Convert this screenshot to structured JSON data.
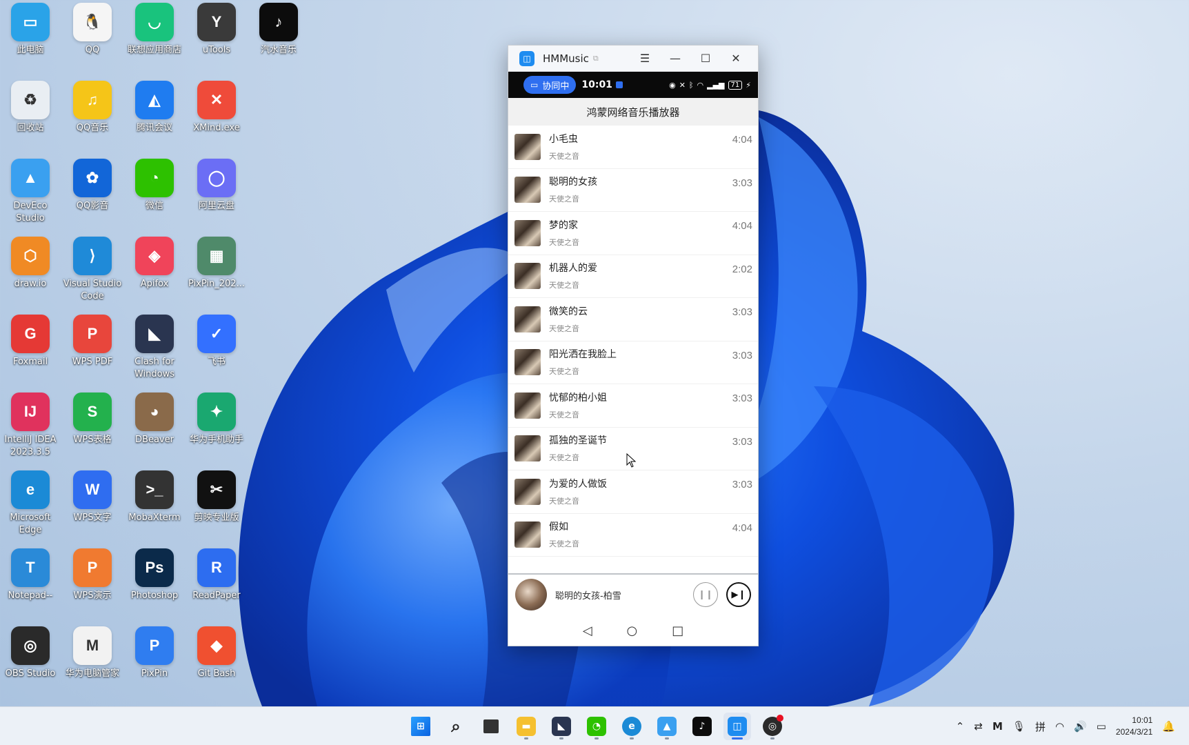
{
  "desktop": {
    "icons": [
      {
        "label": "此电脑",
        "color": "#2aa3e8",
        "glyph": "▭"
      },
      {
        "label": "QQ",
        "color": "#f5f5f5",
        "glyph": "🐧"
      },
      {
        "label": "联想应用商店",
        "color": "#19c37d",
        "glyph": "◡"
      },
      {
        "label": "uTools",
        "color": "#3a3a3a",
        "glyph": "Y"
      },
      {
        "label": "汽水音乐",
        "color": "#0c0c0c",
        "glyph": "♪"
      },
      {
        "label": "回收站",
        "color": "#e9eef3",
        "glyph": "♻"
      },
      {
        "label": "QQ音乐",
        "color": "#f5c518",
        "glyph": "♫"
      },
      {
        "label": "腾讯会议",
        "color": "#1f7cf0",
        "glyph": "◭"
      },
      {
        "label": "XMind.exe",
        "color": "#ef4b3a",
        "glyph": "✕"
      },
      {
        "label": "DevEco Studio",
        "color": "#3aa0f0",
        "glyph": "▲"
      },
      {
        "label": "QQ影音",
        "color": "#1266d8",
        "glyph": "✿"
      },
      {
        "label": "微信",
        "color": "#2dc100",
        "glyph": "◔"
      },
      {
        "label": "阿里云盘",
        "color": "#6b6ef5",
        "glyph": "◯"
      },
      {
        "label": "draw.io",
        "color": "#f08a24",
        "glyph": "⬡"
      },
      {
        "label": "Visual Studio Code",
        "color": "#1f8ad8",
        "glyph": "⟩"
      },
      {
        "label": "Apifox",
        "color": "#f0445a",
        "glyph": "◈"
      },
      {
        "label": "PixPin_202...",
        "color": "#4f8a6a",
        "glyph": "▦"
      },
      {
        "label": "Foxmail",
        "color": "#e53935",
        "glyph": "G"
      },
      {
        "label": "WPS PDF",
        "color": "#e8463c",
        "glyph": "P"
      },
      {
        "label": "Clash for Windows",
        "color": "#2a3550",
        "glyph": "◣"
      },
      {
        "label": "飞书",
        "color": "#3370ff",
        "glyph": "✓"
      },
      {
        "label": "IntelliJ IDEA 2023.3.5",
        "color": "#e0325d",
        "glyph": "IJ"
      },
      {
        "label": "WPS表格",
        "color": "#23b14d",
        "glyph": "S"
      },
      {
        "label": "DBeaver",
        "color": "#8a6a4a",
        "glyph": "◕"
      },
      {
        "label": "华为手机助手",
        "color": "#1aa870",
        "glyph": "✦"
      },
      {
        "label": "Microsoft Edge",
        "color": "#1b8ad6",
        "glyph": "e"
      },
      {
        "label": "WPS文字",
        "color": "#2f6df0",
        "glyph": "W"
      },
      {
        "label": "MobaXterm",
        "color": "#333333",
        "glyph": ">_"
      },
      {
        "label": "剪映专业版",
        "color": "#111111",
        "glyph": "✂"
      },
      {
        "label": "Notepad--",
        "color": "#2a8ad8",
        "glyph": "T"
      },
      {
        "label": "WPS演示",
        "color": "#f07a30",
        "glyph": "P"
      },
      {
        "label": "Photoshop",
        "color": "#0b2a4a",
        "glyph": "Ps"
      },
      {
        "label": "ReadPaper",
        "color": "#2d6df0",
        "glyph": "R"
      },
      {
        "label": "OBS Studio",
        "color": "#2a2a2a",
        "glyph": "◎"
      },
      {
        "label": "华为电脑管家",
        "color": "#f2f2f2",
        "glyph": "M"
      },
      {
        "label": "PixPin",
        "color": "#2f7df0",
        "glyph": "P"
      },
      {
        "label": "Git Bash",
        "color": "#f05030",
        "glyph": "◆"
      }
    ]
  },
  "window": {
    "title": "HMMusic",
    "statusbar": {
      "collab_label": "协同中",
      "time": "10:01",
      "battery": "71"
    },
    "header_title": "鸿蒙网络音乐播放器",
    "songs": [
      {
        "title": "小毛虫",
        "artist": "天使之音",
        "duration": "4:04"
      },
      {
        "title": "聪明的女孩",
        "artist": "天使之音",
        "duration": "3:03"
      },
      {
        "title": "梦的家",
        "artist": "天使之音",
        "duration": "4:04"
      },
      {
        "title": "机器人的爱",
        "artist": "天使之音",
        "duration": "2:02"
      },
      {
        "title": "微笑的云",
        "artist": "天使之音",
        "duration": "3:03"
      },
      {
        "title": "阳光洒在我脸上",
        "artist": "天使之音",
        "duration": "3:03"
      },
      {
        "title": "忧郁的柏小姐",
        "artist": "天使之音",
        "duration": "3:03"
      },
      {
        "title": "孤独的圣诞节",
        "artist": "天使之音",
        "duration": "3:03"
      },
      {
        "title": "为爱的人做饭",
        "artist": "天使之音",
        "duration": "3:03"
      },
      {
        "title": "假如",
        "artist": "天使之音",
        "duration": "4:04"
      }
    ],
    "now_playing": "聪明的女孩-柏雪"
  },
  "taskbar": {
    "apps": [
      "windows-start",
      "search",
      "task-view",
      "file-explorer",
      "clash",
      "wechat",
      "edge",
      "deveco",
      "qishui-music",
      "hmmusic",
      "obs"
    ],
    "clock": {
      "time": "10:01",
      "date": "2024/3/21"
    }
  }
}
